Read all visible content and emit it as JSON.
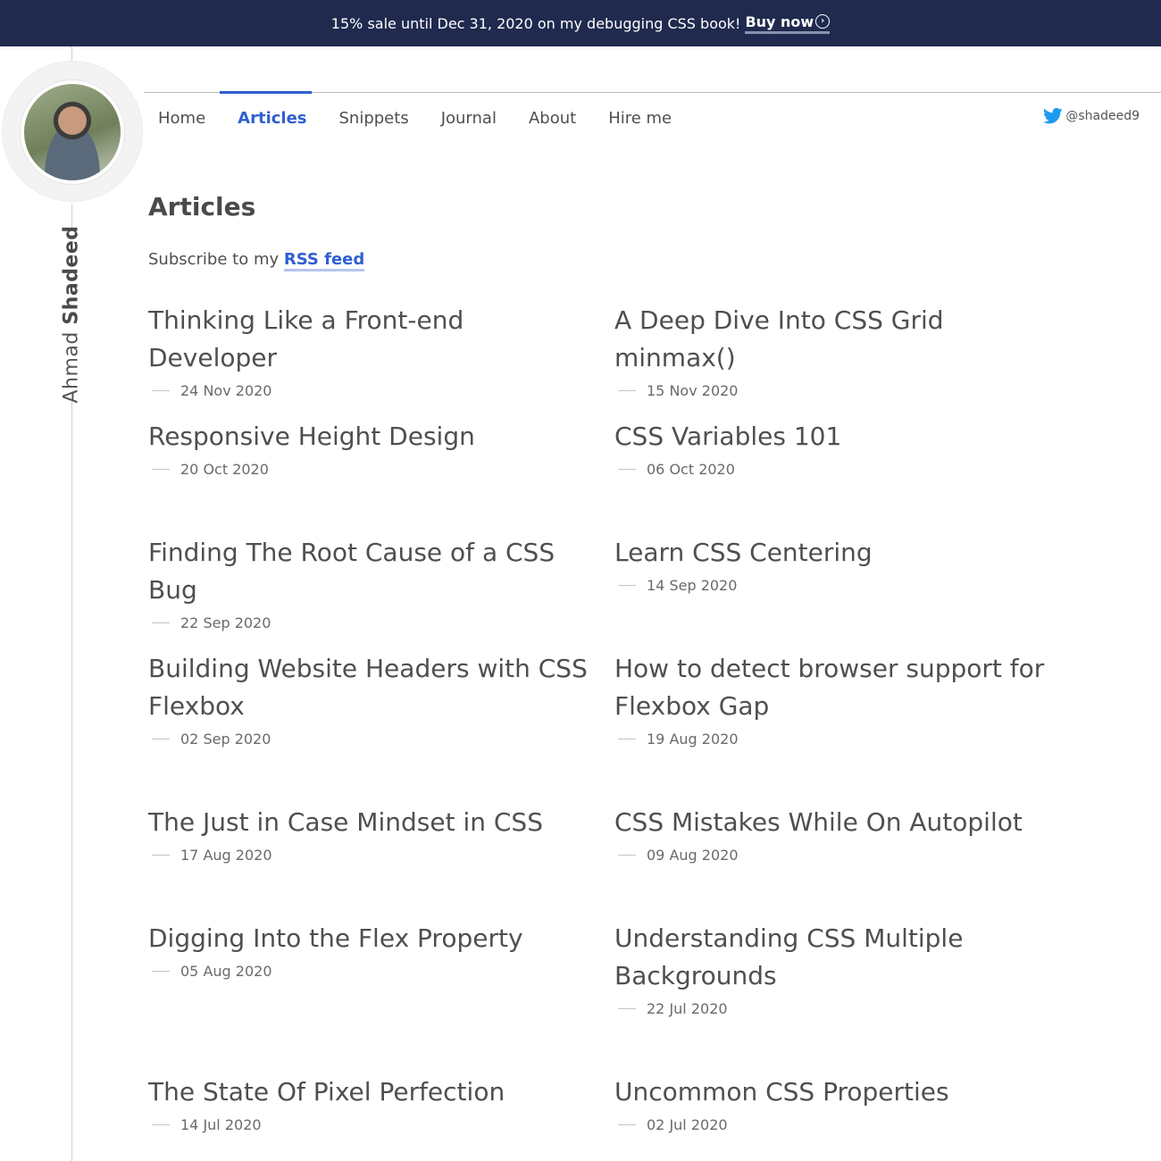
{
  "banner": {
    "text": "15% sale until Dec 31, 2020 on my debugging CSS book!",
    "cta": "Buy now",
    "cta_icon": "arrow-circle-icon"
  },
  "author": {
    "first_name": "Ahmad",
    "last_name": "Shadeed"
  },
  "nav": {
    "items": [
      {
        "label": "Home",
        "active": false
      },
      {
        "label": "Articles",
        "active": true
      },
      {
        "label": "Snippets",
        "active": false
      },
      {
        "label": "Journal",
        "active": false
      },
      {
        "label": "About",
        "active": false
      },
      {
        "label": "Hire me",
        "active": false
      }
    ],
    "twitter": "@shadeed9"
  },
  "page": {
    "title": "Articles",
    "subscribe_prefix": "Subscribe to my",
    "subscribe_link": "RSS feed"
  },
  "articles": [
    {
      "title": "Thinking Like a Front-end Developer",
      "date": "24 Nov 2020"
    },
    {
      "title": "A Deep Dive Into CSS Grid minmax()",
      "date": "15 Nov 2020"
    },
    {
      "title": "Responsive Height Design",
      "date": "20 Oct 2020"
    },
    {
      "title": "CSS Variables 101",
      "date": "06 Oct 2020"
    },
    {
      "title": "Finding The Root Cause of a CSS Bug",
      "date": "22 Sep 2020"
    },
    {
      "title": "Learn CSS Centering",
      "date": "14 Sep 2020"
    },
    {
      "title": "Building Website Headers with CSS Flexbox",
      "date": "02 Sep 2020"
    },
    {
      "title": "How to detect browser support for Flexbox Gap",
      "date": "19 Aug 2020"
    },
    {
      "title": "The Just in Case Mindset in CSS",
      "date": "17 Aug 2020"
    },
    {
      "title": "CSS Mistakes While On Autopilot",
      "date": "09 Aug 2020"
    },
    {
      "title": "Digging Into the Flex Property",
      "date": "05 Aug 2020"
    },
    {
      "title": "Understanding CSS Multiple Backgrounds",
      "date": "22 Jul 2020"
    },
    {
      "title": "The State Of Pixel Perfection",
      "date": "14 Jul 2020"
    },
    {
      "title": "Uncommon CSS Properties",
      "date": "02 Jul 2020"
    }
  ],
  "colors": {
    "banner_bg": "#1f2a4e",
    "accent": "#2f5fd0",
    "text": "#4f4f4f"
  }
}
